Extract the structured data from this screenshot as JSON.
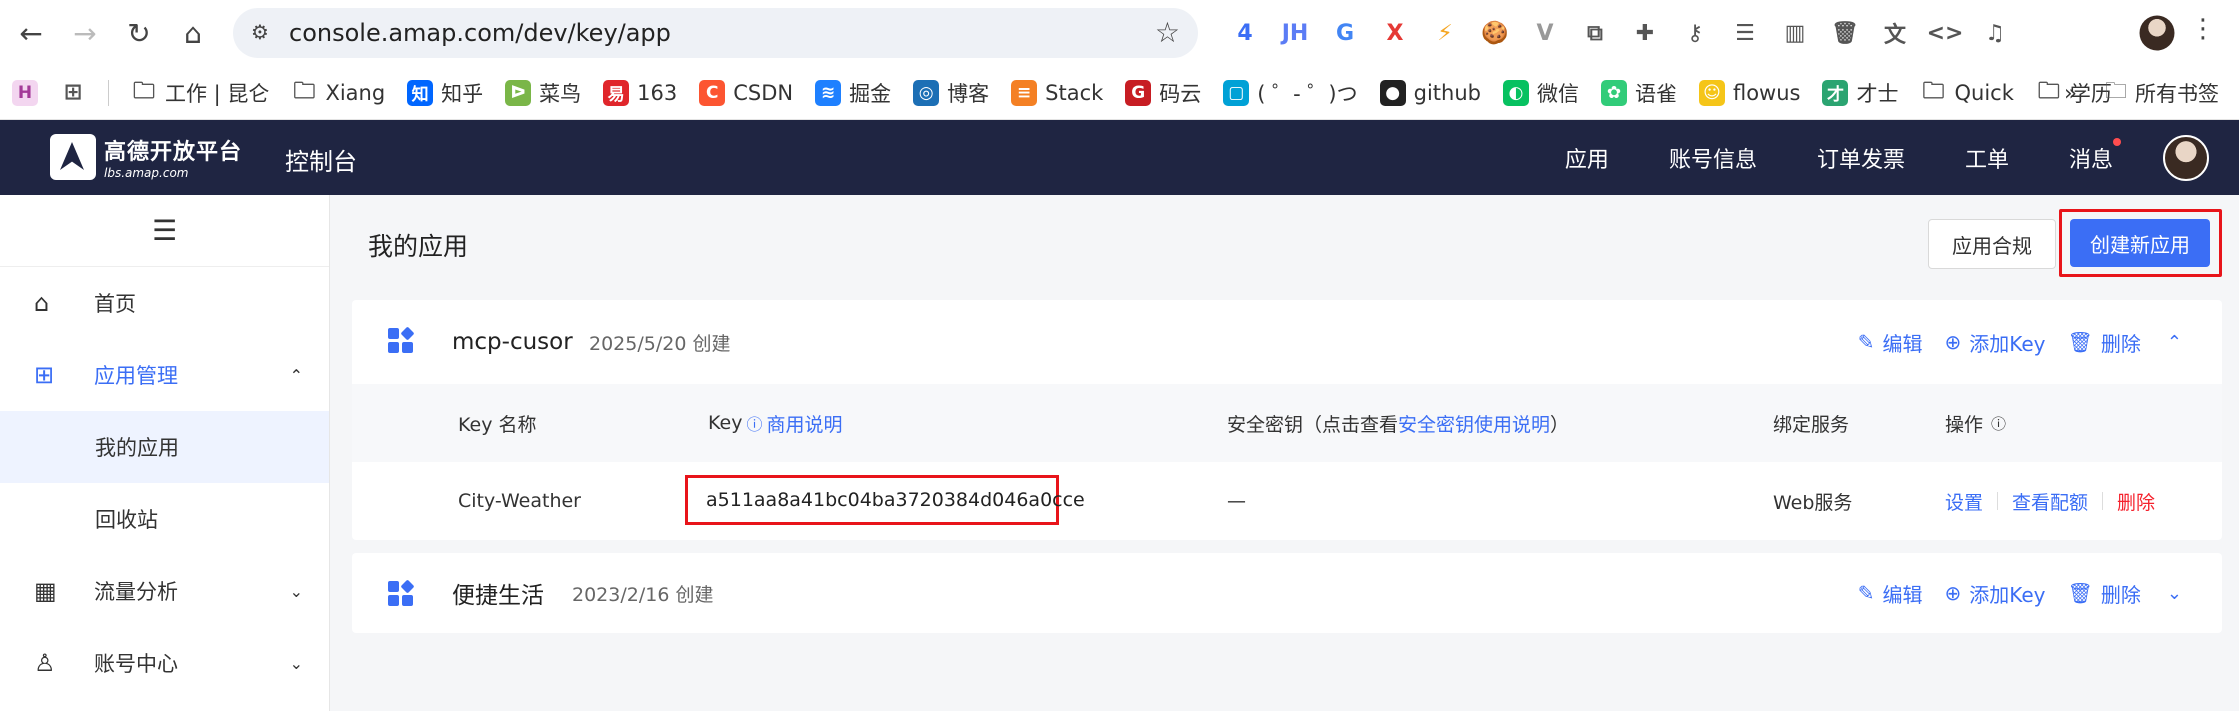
{
  "browser": {
    "url": "console.amap.com/dev/key/app",
    "extensions": [
      {
        "name": "ext-badge-icon",
        "label": "4",
        "color": "#3b6ef5"
      },
      {
        "name": "jh-ext-icon",
        "label": "JH",
        "color": "#5b7cf5"
      },
      {
        "name": "translate-ext-icon",
        "label": "G",
        "color": "#4285f4"
      },
      {
        "name": "x-ext-icon",
        "label": "X",
        "color": "#e53935"
      },
      {
        "name": "speed-ext-icon",
        "label": "⚡",
        "color": "#f5a623"
      },
      {
        "name": "cookie-ext-icon",
        "label": "🍪",
        "color": "#8b5a2b"
      },
      {
        "name": "vue-ext-icon",
        "label": "V",
        "color": "#999"
      },
      {
        "name": "extensions-icon",
        "label": "⧉",
        "color": "#555"
      },
      {
        "name": "puzzle-icon",
        "label": "✚",
        "color": "#555"
      },
      {
        "name": "key-icon",
        "label": "⚷",
        "color": "#555"
      },
      {
        "name": "reading-list-icon",
        "label": "☰",
        "color": "#555"
      },
      {
        "name": "sidepanel-icon",
        "label": "▥",
        "color": "#555"
      },
      {
        "name": "trash-icon",
        "label": "🗑",
        "color": "#555"
      },
      {
        "name": "translate-page-icon",
        "label": "文",
        "color": "#555"
      },
      {
        "name": "code-icon",
        "label": "<>",
        "color": "#555"
      },
      {
        "name": "media-icon",
        "label": "♫",
        "color": "#555"
      }
    ]
  },
  "bookmarks": {
    "items": [
      {
        "label": "工作 | 昆仑",
        "icon": "folder"
      },
      {
        "label": "Xiang",
        "icon": "folder"
      },
      {
        "label": "知乎",
        "icon": "知",
        "color": "#0066ff"
      },
      {
        "label": "菜鸟",
        "icon": "ᐅ",
        "color": "#7ab648"
      },
      {
        "label": "163",
        "icon": "易",
        "color": "#e0262b"
      },
      {
        "label": "CSDN",
        "icon": "C",
        "color": "#fc5531"
      },
      {
        "label": "掘金",
        "icon": "≋",
        "color": "#1e80ff"
      },
      {
        "label": "博客",
        "icon": "◎",
        "color": "#1c6fb5"
      },
      {
        "label": "Stack",
        "icon": "≡",
        "color": "#f48024"
      },
      {
        "label": "码云",
        "icon": "G",
        "color": "#c71d23"
      },
      {
        "label": "( ゜- ゜)つ",
        "icon": "▢",
        "color": "#00a1d6"
      },
      {
        "label": "github",
        "icon": "●",
        "color": "#222"
      },
      {
        "label": "微信",
        "icon": "◐",
        "color": "#07c160"
      },
      {
        "label": "语雀",
        "icon": "✿",
        "color": "#31cc79"
      },
      {
        "label": "flowus",
        "icon": "☺",
        "color": "#f5c518"
      },
      {
        "label": "才士",
        "icon": "才",
        "color": "#2ba471"
      },
      {
        "label": "Quick",
        "icon": "folder"
      },
      {
        "label": "学历",
        "icon": "folder"
      }
    ],
    "more": "»",
    "all": "所有书签"
  },
  "topnav": {
    "logo_line1": "高德开放平台",
    "logo_line2": "lbs.amap.com",
    "console": "控制台",
    "menu": [
      "应用",
      "账号信息",
      "订单发票",
      "工单",
      "消息"
    ]
  },
  "sidebar": {
    "home": "首页",
    "app_mgmt": "应用管理",
    "my_apps": "我的应用",
    "recycle": "回收站",
    "traffic": "流量分析",
    "account": "账号中心"
  },
  "main": {
    "title": "我的应用",
    "compliance": "应用合规",
    "create": "创建新应用",
    "apps": [
      {
        "name": "mcp-cusor",
        "date": "2025/5/20 创建",
        "edit": "编辑",
        "add_key": "添加Key",
        "delete": "删除"
      },
      {
        "name": "便捷生活",
        "date": "2023/2/16 创建",
        "edit": "编辑",
        "add_key": "添加Key",
        "delete": "删除"
      }
    ],
    "table": {
      "col_name": "Key 名称",
      "col_key": "Key",
      "col_key_link": "商用说明",
      "col_secret_prefix": "安全密钥（点击查看",
      "col_secret_link": "安全密钥使用说明",
      "col_secret_suffix": "）",
      "col_service": "绑定服务",
      "col_ops": "操作",
      "row": {
        "name": "City-Weather",
        "key": "a511aa8a41bc04ba3720384d046a0cce",
        "secret": "—",
        "service": "Web服务",
        "op_settings": "设置",
        "op_quota": "查看配额",
        "op_delete": "删除"
      }
    }
  },
  "colors": {
    "accent": "#3b6ef5",
    "nav_bg": "#1f2542",
    "highlight": "#e8141a"
  }
}
